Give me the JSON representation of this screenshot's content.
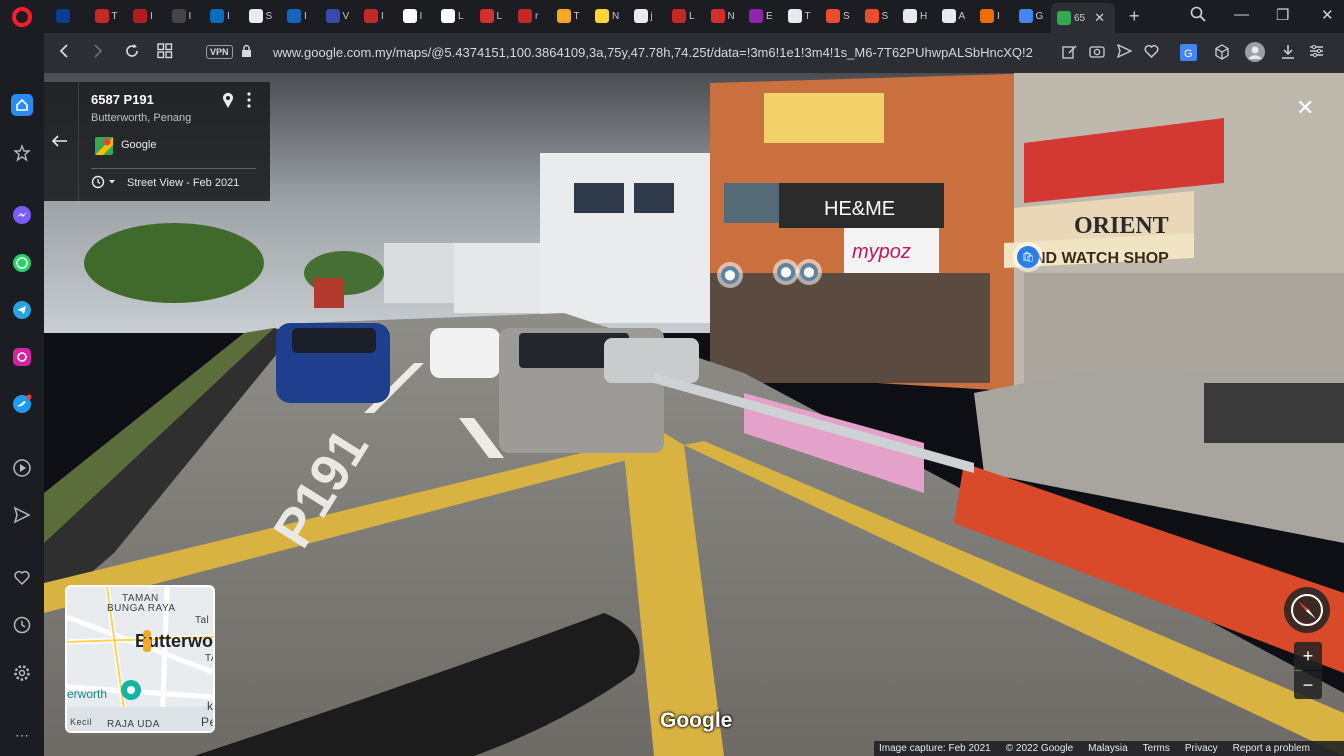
{
  "tabs": [
    {
      "label": "",
      "icon": "nasa-icon",
      "color": "#0b3d91"
    },
    {
      "label": "T",
      "icon": "red-site-icon",
      "color": "#c62828"
    },
    {
      "label": "I",
      "icon": "red-site-icon",
      "color": "#b71c1c"
    },
    {
      "label": "I",
      "icon": "circle-site-icon",
      "color": "#444"
    },
    {
      "label": "I",
      "icon": "outlook-icon",
      "color": "#0f6cbd"
    },
    {
      "label": "S",
      "icon": "s-icon",
      "color": "#e8eaed"
    },
    {
      "label": "I",
      "icon": "blue-site-icon",
      "color": "#1565c0"
    },
    {
      "label": "V",
      "icon": "emblem-icon",
      "color": "#3949ab"
    },
    {
      "label": "I",
      "icon": "red-circle-icon",
      "color": "#c62828"
    },
    {
      "label": "I",
      "icon": "doc-icon",
      "color": "#ffffff"
    },
    {
      "label": "L",
      "icon": "google-icon",
      "color": "#ffffff"
    },
    {
      "label": "L",
      "icon": "maple-leaf-icon",
      "color": "#d32f2f"
    },
    {
      "label": "r",
      "icon": "red-circle-icon",
      "color": "#c62828"
    },
    {
      "label": "T",
      "icon": "seal-icon",
      "color": "#f9a825"
    },
    {
      "label": "N",
      "icon": "arrow-brand-icon",
      "color": "#fdd835"
    },
    {
      "label": "j",
      "icon": "globe-icon",
      "color": "#e8eaed"
    },
    {
      "label": "L",
      "icon": "red-circle-icon",
      "color": "#c62828"
    },
    {
      "label": "N",
      "icon": "news-icon",
      "color": "#d32f2f"
    },
    {
      "label": "E",
      "icon": "colorful-icon",
      "color": "#8e24aa"
    },
    {
      "label": "T",
      "icon": "page-icon",
      "color": "#e8eaed"
    },
    {
      "label": "S",
      "icon": "shop-icon",
      "color": "#ee4d2d"
    },
    {
      "label": "S",
      "icon": "shop-icon",
      "color": "#ee4d2d"
    },
    {
      "label": "H",
      "icon": "globe-icon",
      "color": "#e8eaed"
    },
    {
      "label": "A",
      "icon": "globe-icon",
      "color": "#e8eaed"
    },
    {
      "label": "I",
      "icon": "orange-icon",
      "color": "#ef6c00"
    },
    {
      "label": "G",
      "icon": "translate-icon",
      "color": "#4285f4"
    },
    {
      "label": "65",
      "icon": "maps-icon",
      "color": "#34a853",
      "active": true
    }
  ],
  "address_bar": {
    "vpn_label": "VPN",
    "url": "www.google.com.my/maps/@5.4374151,100.3864109,3a,75y,47.78h,74.25t/data=!3m6!1e1!3m4!1s_M6-7T62PUhwpALSbHncXQ!2"
  },
  "info_card": {
    "title": "6587 P191",
    "subtitle": "Butterworth, Penang",
    "source": "Google",
    "street_view_date": "Street View - Feb 2021"
  },
  "road_marking": "P191",
  "minimap": {
    "labels": [
      "TAMAN",
      "BUNGA RAYA",
      "Butterwo",
      "TA",
      "Tal",
      "erworth",
      "Kecil",
      "RAJA UDA",
      "k",
      "Pe"
    ]
  },
  "watermark": "Google",
  "footer": {
    "capture": "Image capture: Feb 2021",
    "copyright": "© 2022 Google",
    "country": "Malaysia",
    "terms": "Terms",
    "privacy": "Privacy",
    "report": "Report a problem"
  },
  "signs": {
    "orient": "ORIENT",
    "watch_shop": "ND WATCH SHOP",
    "heme": "HE&ME",
    "mypoz": "mypoz"
  }
}
